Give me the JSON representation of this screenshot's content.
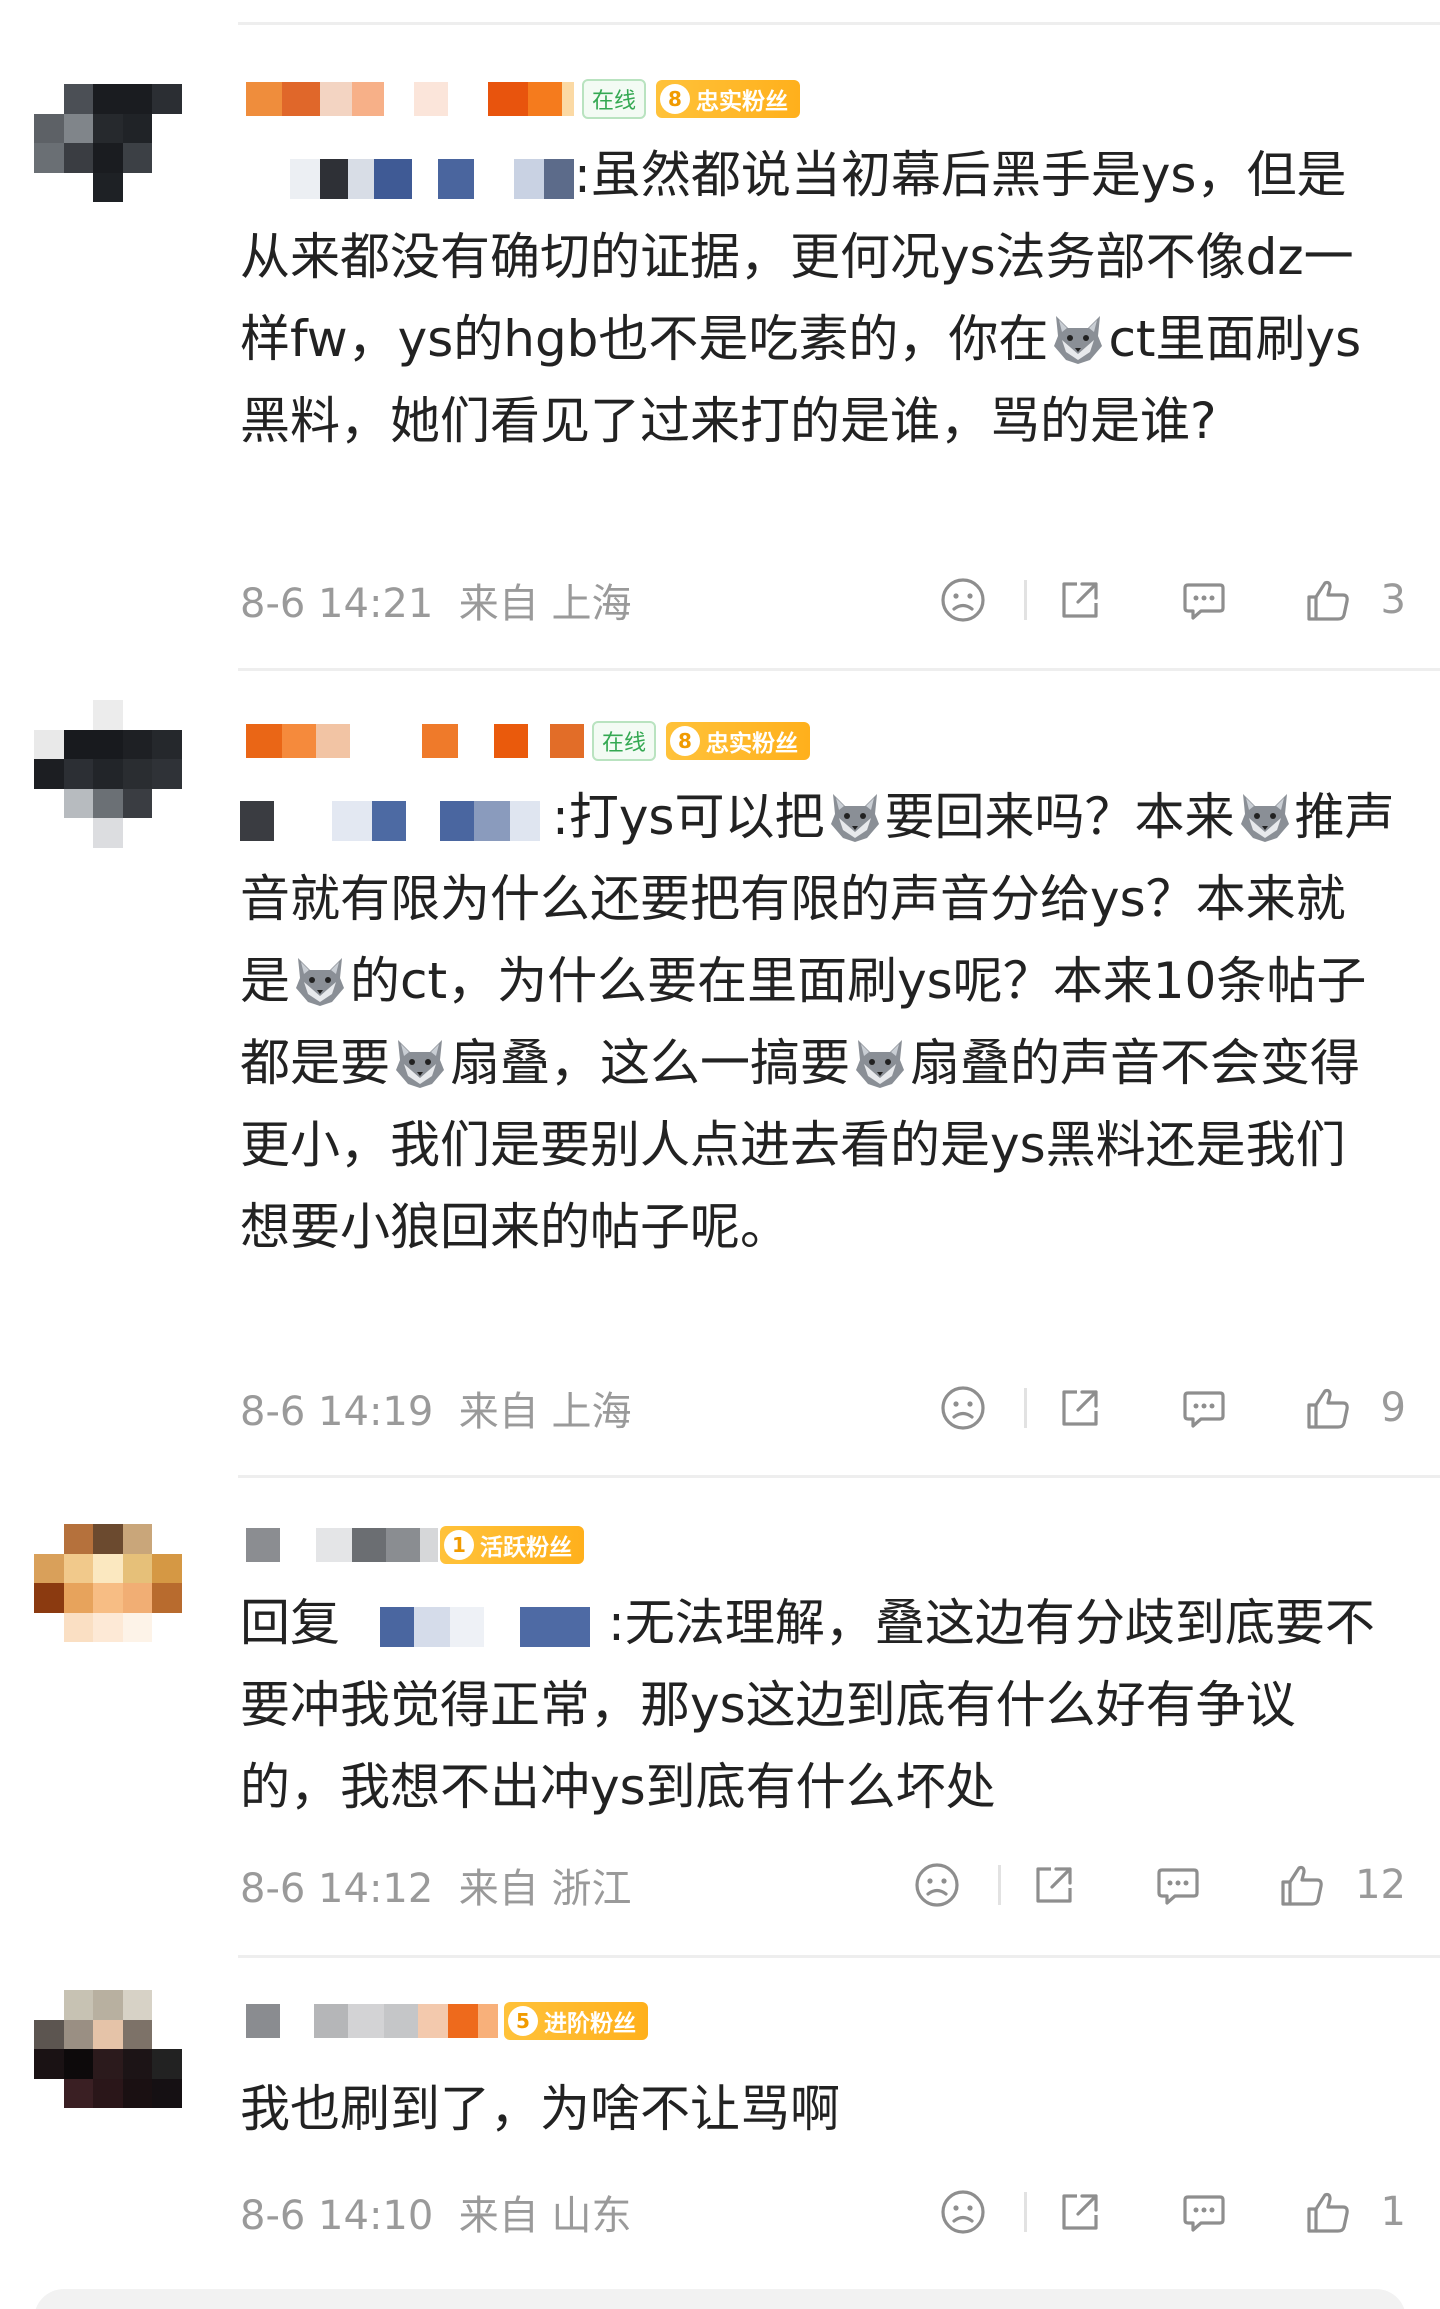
{
  "comments": [
    {
      "online_badge": "在线",
      "fan_badge": {
        "level": "8",
        "label": "忠实粉丝"
      },
      "text_after_mention": ":虽然都说当初幕后黑手是ys，但是从来都没有确切的证据，更何况ys法务部不像dz一样fw，ys的hgb也不是吃素的，你在",
      "text_tail": "ct里面刷ys黑料，她们看见了过来打的是谁，骂的是谁?",
      "time": "8-6 14:21",
      "location_prefix": "来自",
      "location": "上海",
      "likes": "3"
    },
    {
      "online_badge": "在线",
      "fan_badge": {
        "level": "8",
        "label": "忠实粉丝"
      },
      "segments": [
        ":打ys可以把",
        "要回来吗？本来",
        "推声音就有限为什么还要把有限的声音分给ys？本来就是",
        "的ct，为什么要在里面刷ys呢？本来10条帖子都是要",
        "扇叠，这么一搞要",
        "扇叠的声音不会变得更小，我们是要别人点进去看的是ys黑料还是我们想要小狼回来的帖子呢。"
      ],
      "time": "8-6 14:19",
      "location_prefix": "来自",
      "location": "上海",
      "likes": "9"
    },
    {
      "fan_badge": {
        "level": "1",
        "label": "活跃粉丝"
      },
      "reply_prefix": "回复",
      "text_after_mention": ":无法理解，叠这边有分歧到底要不要冲我觉得正常，那ys这边到底有什么好有争议的，我想不出冲ys到底有什么坏处",
      "time": "8-6 14:12",
      "location_prefix": "来自",
      "location": "浙江",
      "likes": "12"
    },
    {
      "fan_badge": {
        "level": "5",
        "label": "进阶粉丝"
      },
      "text": "我也刷到了，为啥不让骂啊",
      "time": "8-6 14:10",
      "location_prefix": "来自",
      "location": "山东",
      "likes": "1"
    }
  ],
  "icons": {
    "dislike": "sad-face-icon",
    "share": "share-icon",
    "reply": "comment-bubble-icon",
    "like": "thumbs-up-icon",
    "emoji": "wolf-emoji-icon"
  },
  "colors": {
    "text": "#222222",
    "meta": "#9a9a9a",
    "online_green": "#34a852",
    "fan_gold": "#ffb01c"
  }
}
